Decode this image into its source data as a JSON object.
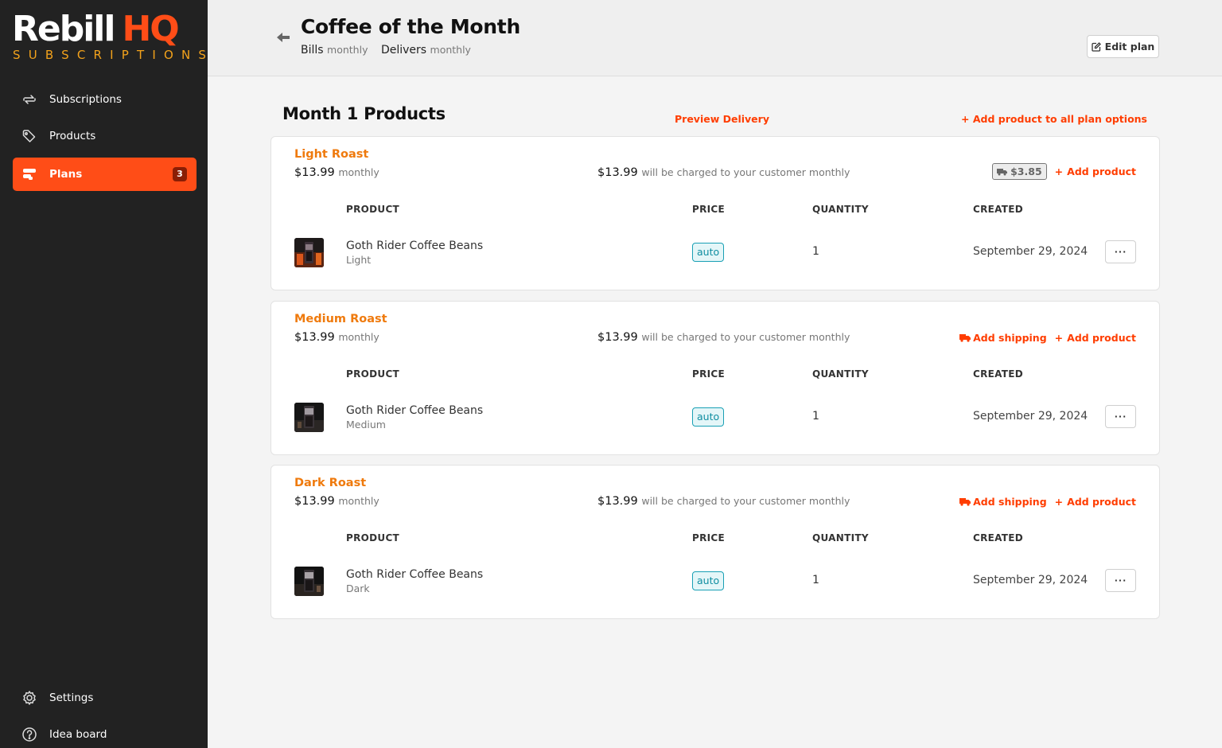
{
  "brand": {
    "name_main": "Rebill",
    "name_accent": "HQ",
    "tagline": "SUBSCRIPTIONS",
    "accent_color": "#ff4d17",
    "tagline_color": "#f3a21b"
  },
  "sidebar": {
    "items": [
      {
        "label": "Subscriptions",
        "icon": "refresh-icon"
      },
      {
        "label": "Products",
        "icon": "tag-icon"
      },
      {
        "label": "Plans",
        "icon": "plans-icon",
        "badge": "3",
        "active": true
      }
    ],
    "bottom_items": [
      {
        "label": "Settings",
        "icon": "gear-icon"
      },
      {
        "label": "Idea board",
        "icon": "question-icon"
      }
    ]
  },
  "header": {
    "title": "Coffee of the Month",
    "bills_label": "Bills",
    "bills_value": "monthly",
    "delivers_label": "Delivers",
    "delivers_value": "monthly",
    "edit_label": "Edit plan"
  },
  "section": {
    "title": "Month 1 Products",
    "preview_label": "Preview Delivery",
    "add_all_label": "Add product to all plan options"
  },
  "columns": {
    "product": "PRODUCT",
    "price": "PRICE",
    "quantity": "QUANTITY",
    "created": "CREATED"
  },
  "options": [
    {
      "name": "Light Roast",
      "price": "$13.99",
      "interval": "monthly",
      "charge_amount": "$13.99",
      "charge_text": "will be charged to your customer monthly",
      "shipping_price": "$3.85",
      "add_product_label": "Add product",
      "product": {
        "name": "Goth Rider Coffee Beans",
        "variant": "Light",
        "price_tag": "auto",
        "quantity": "1",
        "created": "September 29, 2024"
      }
    },
    {
      "name": "Medium Roast",
      "price": "$13.99",
      "interval": "monthly",
      "charge_amount": "$13.99",
      "charge_text": "will be charged to your customer monthly",
      "add_shipping_label": "Add shipping",
      "add_product_label": "Add product",
      "product": {
        "name": "Goth Rider Coffee Beans",
        "variant": "Medium",
        "price_tag": "auto",
        "quantity": "1",
        "created": "September 29, 2024"
      }
    },
    {
      "name": "Dark Roast",
      "price": "$13.99",
      "interval": "monthly",
      "charge_amount": "$13.99",
      "charge_text": "will be charged to your customer monthly",
      "add_shipping_label": "Add shipping",
      "add_product_label": "Add product",
      "product": {
        "name": "Goth Rider Coffee Beans",
        "variant": "Dark",
        "price_tag": "auto",
        "quantity": "1",
        "created": "September 29, 2024"
      }
    }
  ],
  "more_label": "···"
}
